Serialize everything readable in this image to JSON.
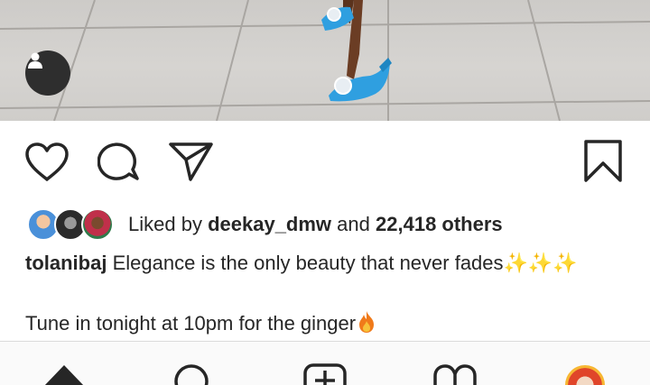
{
  "post": {
    "likes": {
      "prefix": "Liked by",
      "liker": "deekay_dmw",
      "conjunction": "and",
      "count": "22,418 others"
    },
    "caption": {
      "username": "tolanibaj",
      "text": "Elegance is the only beauty that never fades",
      "line2": "Tune in tonight at 10pm for the ginger"
    }
  },
  "icons": {
    "like": "heart-icon",
    "comment": "comment-icon",
    "share": "send-icon",
    "save": "bookmark-icon",
    "tag": "person-icon",
    "nav": [
      "home-icon",
      "search-icon",
      "add-post-icon",
      "activity-icon",
      "profile-avatar"
    ]
  },
  "colors": {
    "text": "#262626",
    "shoe": "#2f9fe0",
    "sparkle": "#f2b20f",
    "fire": "#f07a1a"
  }
}
